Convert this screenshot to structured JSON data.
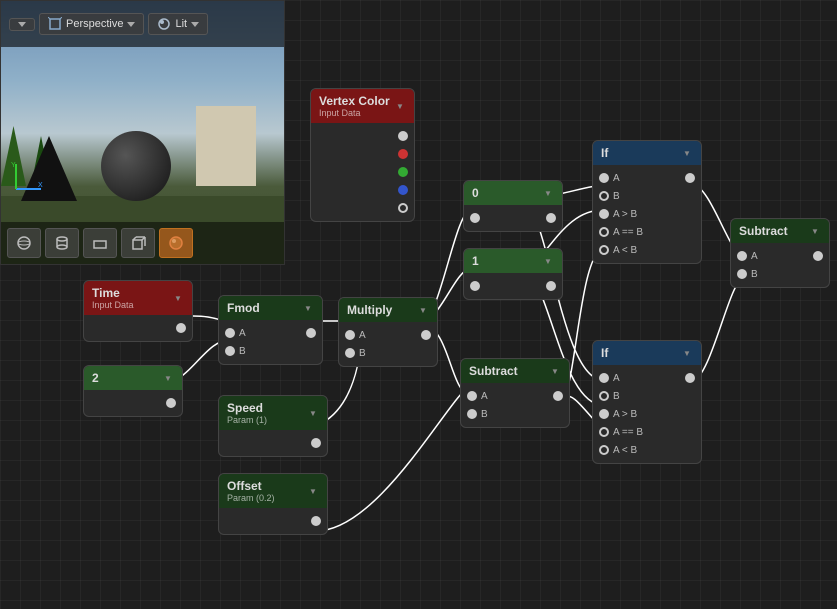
{
  "viewport": {
    "perspective_label": "Perspective",
    "lit_label": "Lit",
    "dropdown_icon": "▼"
  },
  "nodes": {
    "vertex_color": {
      "title": "Vertex Color",
      "subtitle": "Input Data",
      "pins": [
        "white",
        "red",
        "green",
        "blue",
        "white"
      ]
    },
    "time": {
      "title": "Time",
      "subtitle": "Input Data"
    },
    "num2": {
      "title": "2"
    },
    "fmod": {
      "title": "Fmod",
      "pin_a": "A",
      "pin_b": "B"
    },
    "multiply": {
      "title": "Multiply",
      "pin_a": "A",
      "pin_b": "B"
    },
    "speed": {
      "title": "Speed",
      "subtitle": "Param (1)"
    },
    "offset": {
      "title": "Offset",
      "subtitle": "Param (0.2)"
    },
    "subtract_bottom": {
      "title": "Subtract",
      "pin_a": "A",
      "pin_b": "B"
    },
    "zero": {
      "title": "0"
    },
    "one": {
      "title": "1"
    },
    "if_top": {
      "title": "If",
      "pin_a": "A",
      "pin_b": "B",
      "pin_agb": "A > B",
      "pin_aeb": "A == B",
      "pin_alb": "A < B"
    },
    "if_bottom": {
      "title": "If",
      "pin_a": "A",
      "pin_b": "B",
      "pin_agb": "A > B",
      "pin_aeb": "A == B",
      "pin_alb": "A < B"
    },
    "subtract_right": {
      "title": "Subtract",
      "pin_a": "A",
      "pin_b": "B"
    }
  },
  "icons": {
    "sphere": "●",
    "box": "■",
    "plane": "▬",
    "cube": "▪",
    "material": "◆"
  }
}
